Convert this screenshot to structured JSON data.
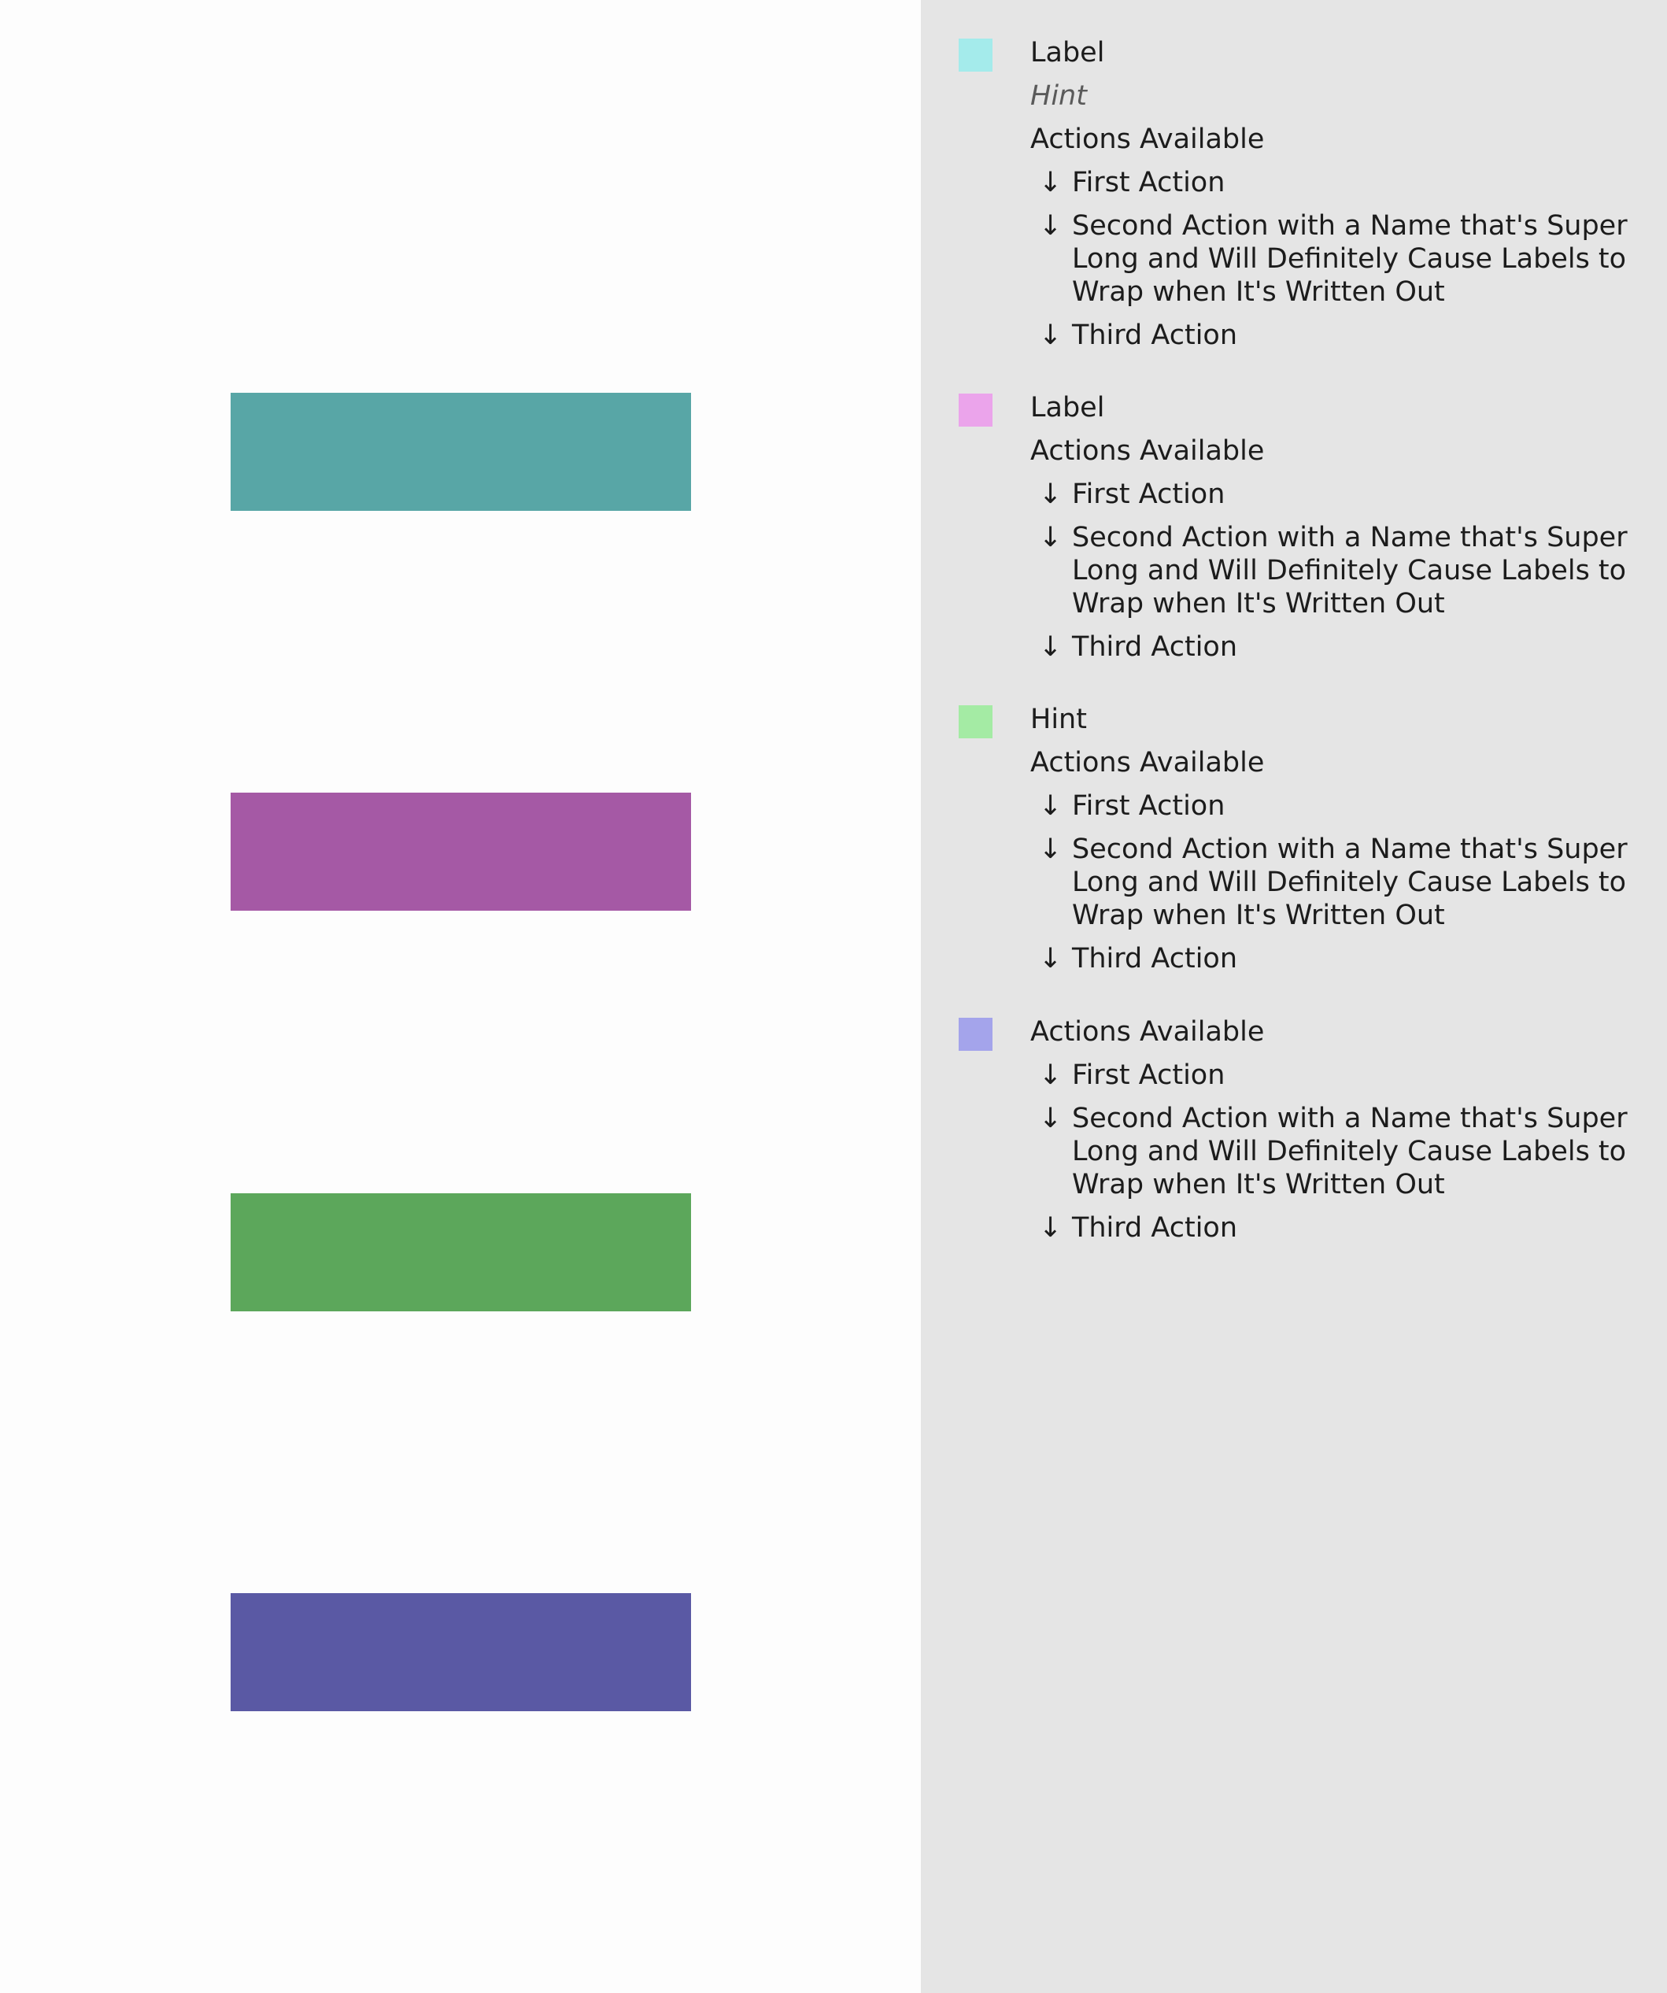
{
  "preview": {
    "bars": [
      {
        "color": "#58a6a6"
      },
      {
        "color": "#a559a5"
      },
      {
        "color": "#5ca75b"
      },
      {
        "color": "#5a59a4"
      }
    ]
  },
  "legend": {
    "arrow_glyph": "↓",
    "entries": [
      {
        "swatch_color": "#a4ebeb",
        "label": "Label",
        "hint": "Hint",
        "actions_heading": "Actions Available",
        "actions": [
          "First Action",
          "Second Action with a Name that's Super\nLong and Will Definitely Cause Labels to\nWrap when It's Written Out",
          "Third Action"
        ]
      },
      {
        "swatch_color": "#eba4eb",
        "label": "Label",
        "actions_heading": "Actions Available",
        "actions": [
          "First Action",
          "Second Action with a Name that's Super\nLong and Will Definitely Cause Labels to\nWrap when It's Written Out",
          "Third Action"
        ]
      },
      {
        "swatch_color": "#a4eba4",
        "hint": "Hint",
        "actions_heading": "Actions Available",
        "actions": [
          "First Action",
          "Second Action with a Name that's Super\nLong and Will Definitely Cause Labels to\nWrap when It's Written Out",
          "Third Action"
        ]
      },
      {
        "swatch_color": "#a4a4eb",
        "actions_heading": "Actions Available",
        "actions": [
          "First Action",
          "Second Action with a Name that's Super\nLong and Will Definitely Cause Labels to\nWrap when It's Written Out",
          "Third Action"
        ]
      }
    ]
  }
}
